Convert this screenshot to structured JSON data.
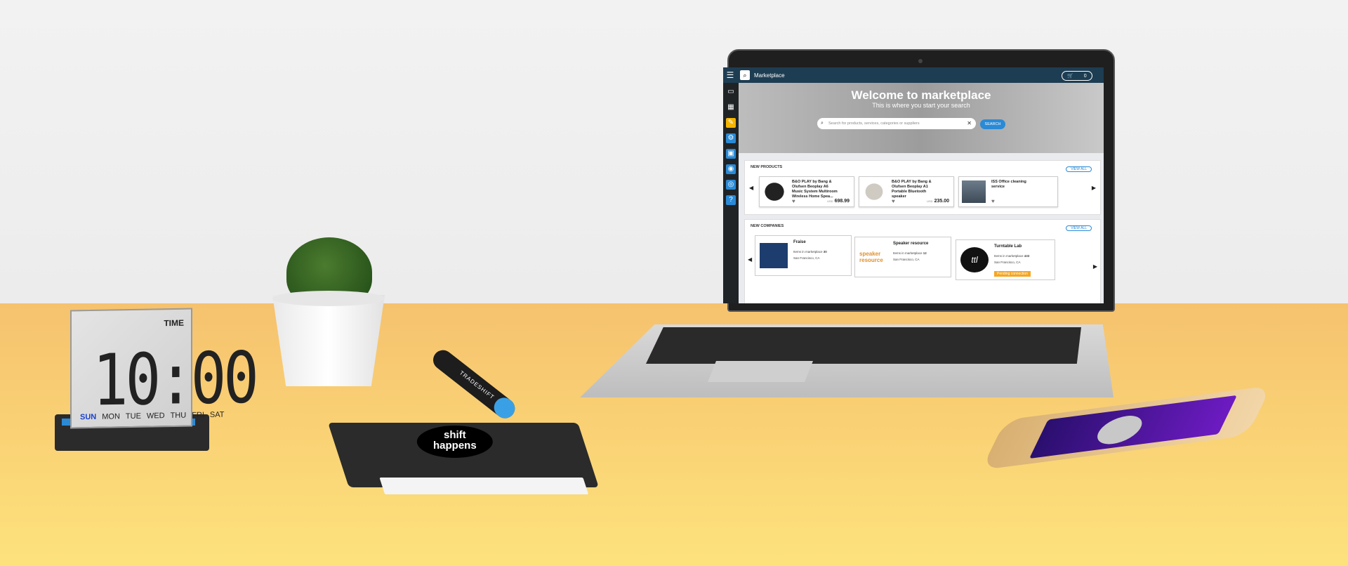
{
  "clock": {
    "label": "TIME",
    "time": "10:00",
    "days": [
      "SUN",
      "MON",
      "TUE",
      "WED",
      "THU",
      "FRI",
      "SAT"
    ],
    "active_day": "SUN"
  },
  "pen": {
    "brand": "TRADESHIFT"
  },
  "notebook": {
    "logo_line1": "shift",
    "logo_line2": "happens"
  },
  "app": {
    "menu_icon": "menu-icon",
    "title": "Marketplace",
    "cart_count": "0",
    "sidebar_icons": [
      "inbox-icon",
      "apps-grid-icon",
      "document-icon",
      "settings-icon",
      "cart-icon",
      "people-icon",
      "contacts-icon",
      "help-icon"
    ]
  },
  "hero": {
    "title": "Welcome to marketplace",
    "subtitle": "This is where you start your search",
    "search_placeholder": "Search for products, services, categories or suppliers",
    "search_button": "SEARCH"
  },
  "new_products": {
    "heading": "NEW PRODUCTS",
    "view_all": "VIEW ALL",
    "items": [
      {
        "name": "B&O PLAY by Bang & Olufsen Beoplay A6 Music System Multiroom Wireless Home Spea...",
        "currency": "USD",
        "price": "698.99"
      },
      {
        "name": "B&O PLAY by Bang & Olufsen Beoplay A1 Portable Bluetooth speaker",
        "currency": "USD",
        "price": "235.00"
      },
      {
        "name": "ISS Office cleaning service",
        "currency": "",
        "price": ""
      }
    ]
  },
  "new_companies": {
    "heading": "NEW COMPANIES",
    "view_all": "VIEW ALL",
    "items_label": "Items in marketplace",
    "items": [
      {
        "name": "Fraise",
        "count": "30",
        "location": "San Francisco, CA",
        "logo": "",
        "badge": ""
      },
      {
        "name": "Speaker resource",
        "count": "12",
        "location": "San Francisco, CA",
        "logo": "speaker resource",
        "badge": ""
      },
      {
        "name": "Turntable Lab",
        "count": "433",
        "location": "San Francisco, CA",
        "logo": "ttl",
        "badge": "Pending connection"
      }
    ]
  }
}
